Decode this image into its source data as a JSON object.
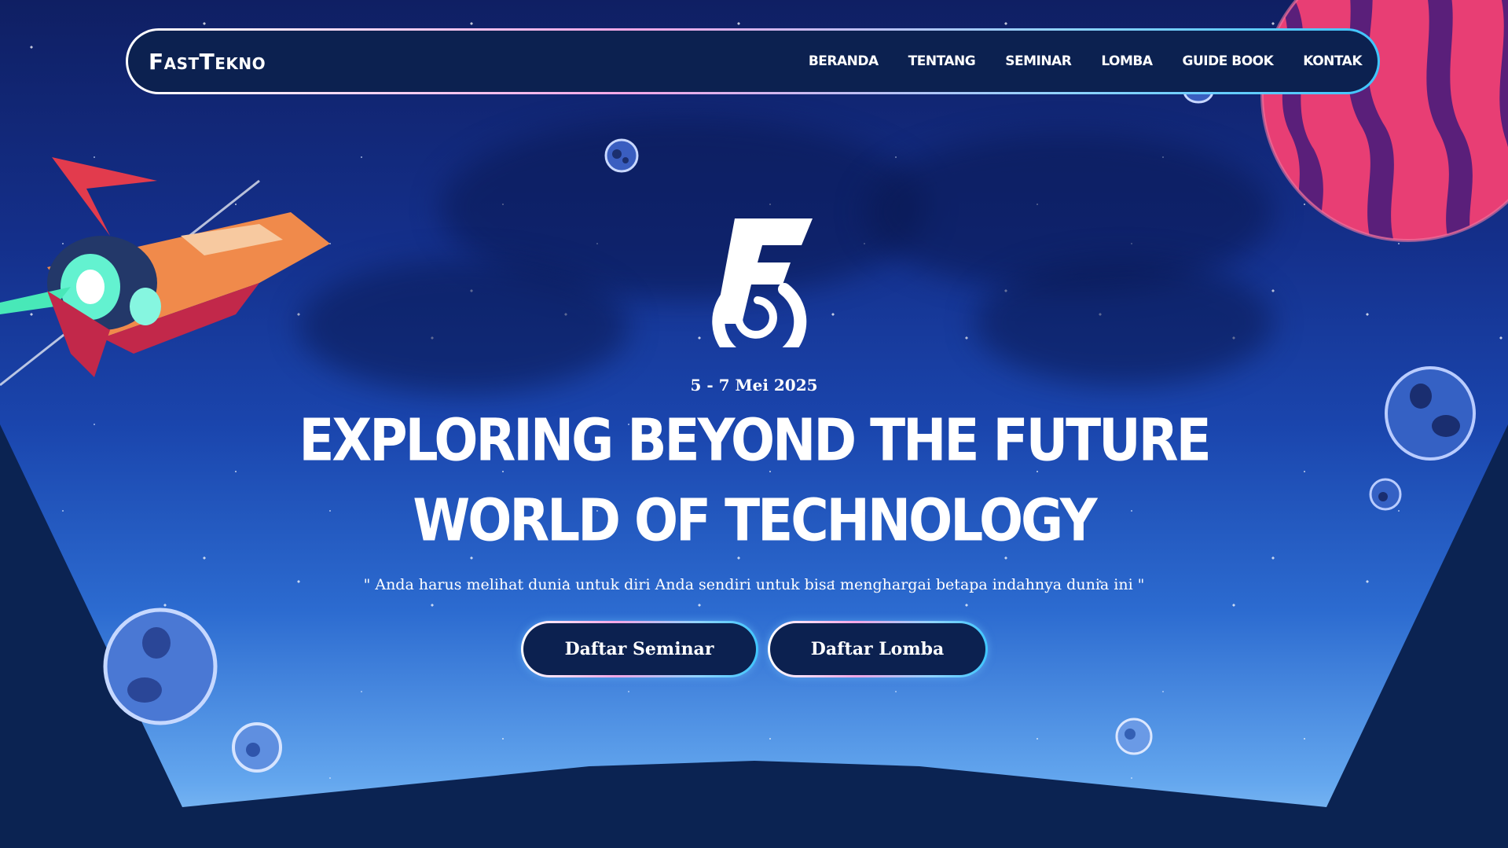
{
  "brand": {
    "name": "FastTekno"
  },
  "nav": {
    "items": [
      {
        "label": "BERANDA"
      },
      {
        "label": "TENTANG"
      },
      {
        "label": "SEMINAR"
      },
      {
        "label": "LOMBA"
      },
      {
        "label": "GUIDE BOOK"
      },
      {
        "label": "KONTAK"
      }
    ]
  },
  "hero": {
    "date": "5 - 7 Mei 2025",
    "title_line1": "EXPLORING BEYOND THE FUTURE",
    "title_line2": "WORLD OF TECHNOLOGY",
    "quote": "\" Anda harus melihat dunia untuk diri Anda sendiri untuk bisa menghargai betapa indahnya dunia ini \"",
    "buttons": {
      "seminar": "Daftar Seminar",
      "lomba": "Daftar Lomba"
    },
    "logo_icon": "fasttekno-logo-icon"
  },
  "decorations": {
    "rocket_icon": "rocket-icon",
    "planet_icon": "planet-icon",
    "asteroid_icon": "asteroid-icon"
  },
  "colors": {
    "background": "#0b2352",
    "nav_bg": "#0c2150",
    "sky_top": "#0f1f63",
    "sky_bottom": "#8cc4f7",
    "border_pink": "#f4a7e6",
    "border_cyan": "#3fc6ff",
    "planet": "#e83e74"
  }
}
